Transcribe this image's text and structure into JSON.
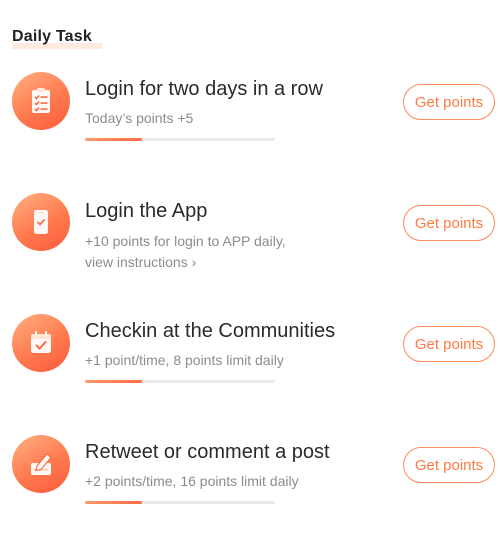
{
  "section": {
    "title": "Daily Task"
  },
  "tasks": [
    {
      "icon": "clipboard-checklist-icon",
      "title": "Login for two days in a row",
      "desc": "Today’s points +5",
      "progress": 0.3,
      "button": "Get points"
    },
    {
      "icon": "phone-check-icon",
      "title": "Login the App",
      "desc": "+10 points for login to APP daily,",
      "link": "view instructions ›",
      "button": "Get points"
    },
    {
      "icon": "calendar-check-icon",
      "title": "Checkin at the Communities",
      "desc": "+1 point/time, 8 points limit daily",
      "progress": 0.3,
      "button": "Get points"
    },
    {
      "icon": "edit-post-icon",
      "title": "Retweet or comment a post",
      "desc": "+2 points/time, 16 points limit daily",
      "progress": 0.3,
      "button": "Get points"
    }
  ],
  "colors": {
    "accent": "#ff7a45",
    "icon_gradient_start": "#ffb184",
    "icon_gradient_end": "#fb5a3b",
    "progress_track": "#e9e9e9"
  }
}
